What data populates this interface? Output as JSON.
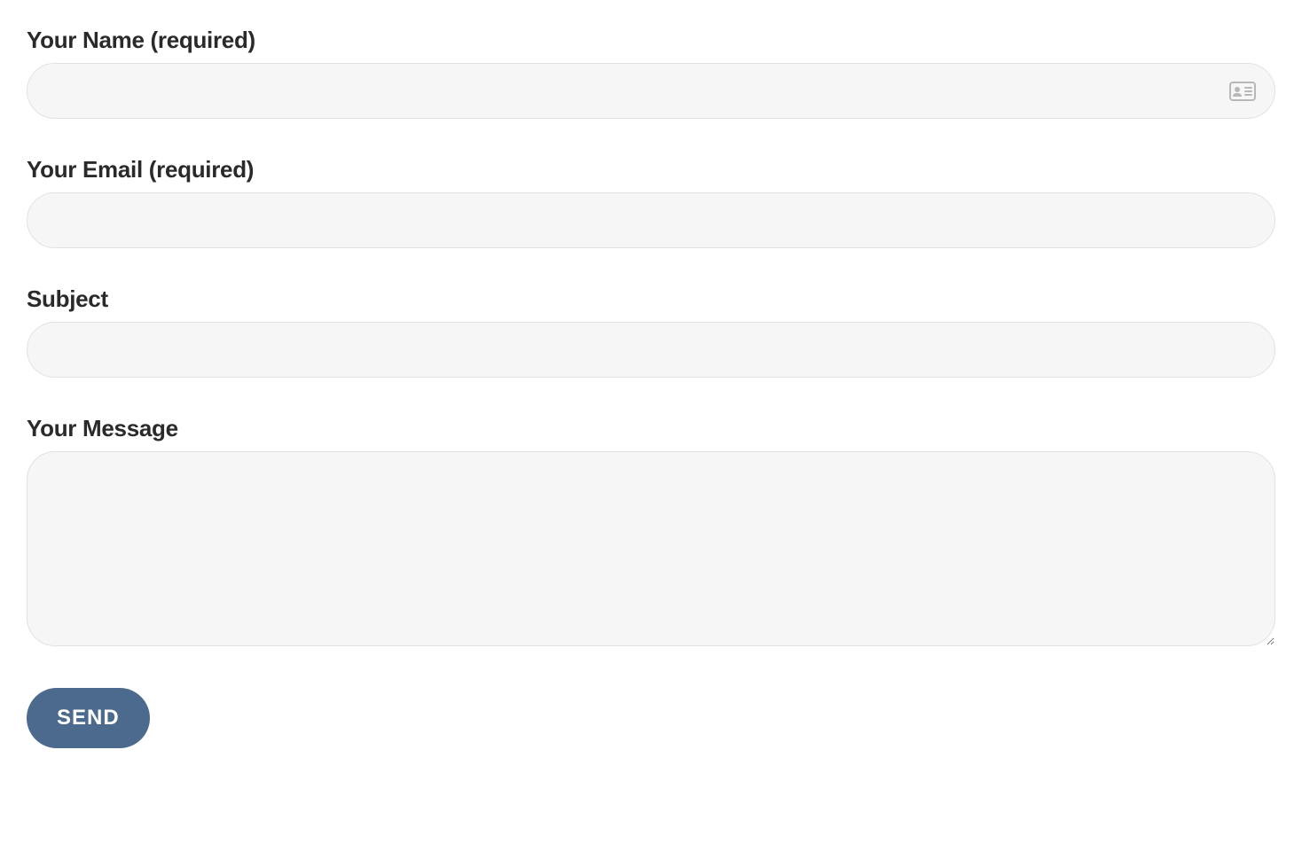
{
  "form": {
    "name": {
      "label": "Your Name (required)",
      "value": ""
    },
    "email": {
      "label": "Your Email (required)",
      "value": ""
    },
    "subject": {
      "label": "Subject",
      "value": ""
    },
    "message": {
      "label": "Your Message",
      "value": ""
    },
    "submit_label": "SEND"
  },
  "colors": {
    "button_bg": "#4c6a8d",
    "input_bg": "#f6f6f6",
    "input_border": "#e2e2e2",
    "label_color": "#2a2a2a"
  }
}
